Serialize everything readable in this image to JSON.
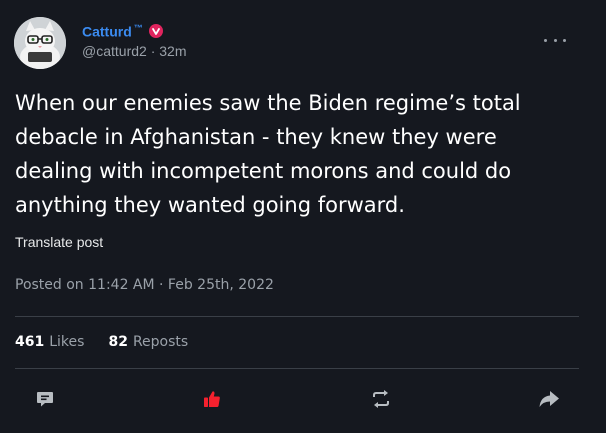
{
  "author": {
    "display_name": "Catturd",
    "tm": "™",
    "verified_icon": "verified-badge-icon",
    "handle": "@catturd2",
    "separator": "·",
    "time_ago": "32m",
    "avatar_icon": "cat-avatar"
  },
  "post": {
    "lines": [
      "When our enemies saw the Biden regime’s total",
      "debacle in Afghanistan - they knew they were",
      "dealing with incompetent morons and could do",
      "anything they wanted going forward."
    ],
    "translate_label": "Translate post",
    "posted_label": "Posted on 11:42 AM · Feb 25th, 2022"
  },
  "stats": {
    "likes_count": "461",
    "likes_label": "Likes",
    "reposts_count": "82",
    "reposts_label": "Reposts"
  },
  "actions": {
    "reply_icon": "comment-icon",
    "like_icon": "thumbs-up-icon",
    "repost_icon": "repost-icon",
    "share_icon": "share-icon",
    "like_color": "#f4212e"
  },
  "colors": {
    "background": "#15181f",
    "name": "#3b8bf0",
    "muted": "#9aa1a9",
    "verified": "#e0245e"
  }
}
